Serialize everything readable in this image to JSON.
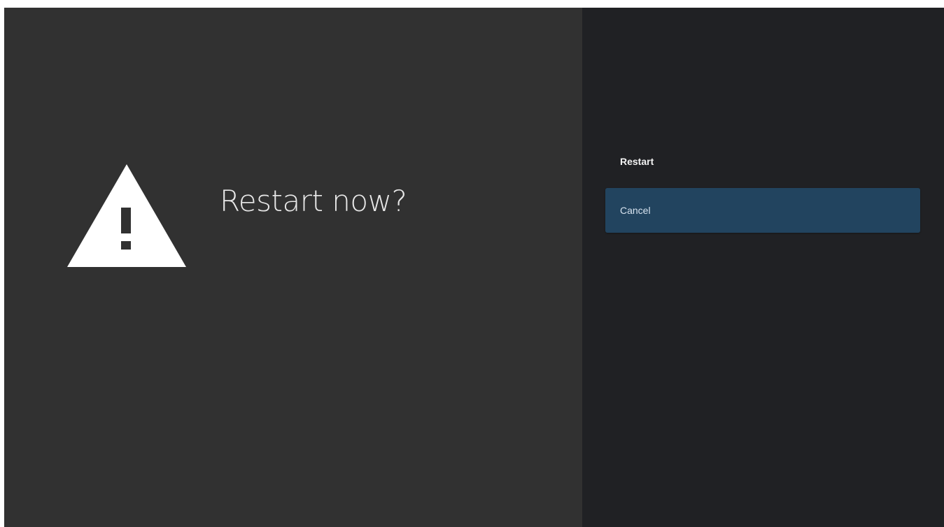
{
  "dialog": {
    "title": "Restart now?",
    "icon": "warning-icon"
  },
  "actions": {
    "items": [
      {
        "label": "Restart",
        "focused": false
      },
      {
        "label": "Cancel",
        "focused": true
      }
    ]
  },
  "colors": {
    "left_background": "#313131",
    "right_background": "#202124",
    "focused_item": "#22445f",
    "icon": "#ffffff"
  }
}
